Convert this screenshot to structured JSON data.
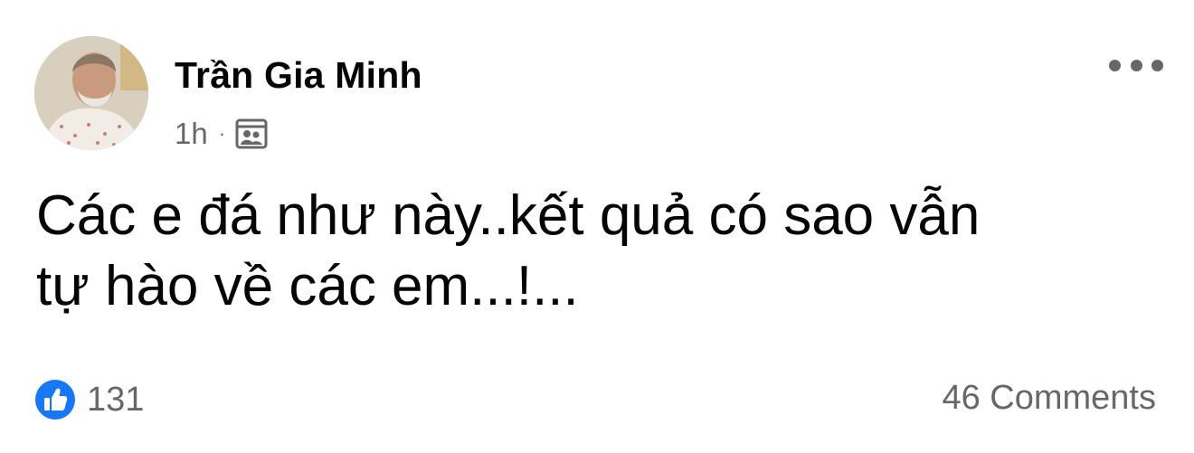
{
  "post": {
    "author": "Trần Gia Minh",
    "timestamp": "1h",
    "separator": "·",
    "audience_icon": "group-audience-icon",
    "more_icon": "more-options-icon",
    "text_lines": [
      "Các e đá như này..kết quả có sao vẫn",
      "tự hào về các em...!..."
    ],
    "reactions": {
      "icon": "like-icon",
      "count": "131",
      "color": "#1877f2"
    },
    "comments_label": "46 Comments"
  }
}
